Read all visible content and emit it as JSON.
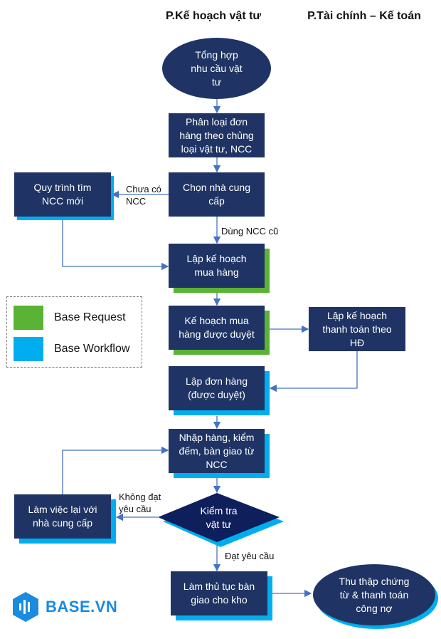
{
  "headers": {
    "left": "P.Kế hoạch vật tư",
    "right": "P.Tài chính – Kế toán"
  },
  "nodes": {
    "tong_hop": "Tổng hợp\nnhu cầu vật\ntư",
    "phan_loai": "Phân loại đơn\nhàng theo chủng\nloại vật tư, NCC",
    "chon_ncc": "Chọn nhà cung\ncấp",
    "quy_trinh": "Quy trình tìm\nNCC mới",
    "lap_ke_hoach": "Lập kế hoạch\nmua hàng",
    "ke_hoach_duyet": "Kế hoạch mua\nhàng được duyệt",
    "ke_hoach_thanh_toan": "Lập kế hoạch\nthanh toán theo\nHĐ",
    "lap_don_hang": "Lập đơn hàng\n(được duyệt)",
    "nhap_hang": "Nhập hàng, kiểm\nđếm, bàn giao từ\nNCC",
    "kiem_tra": "Kiểm tra\nvật tư",
    "lam_viec_lai": "Làm việc lại với\nnhà cung cấp",
    "ban_giao": "Làm thủ tục bàn\ngiao cho kho",
    "thu_thap": "Thu thập chứng\ntừ & thanh toán\ncông nợ"
  },
  "edge_labels": {
    "chua_co": "Chưa có\nNCC",
    "dung_ncc_cu": "Dùng NCC cũ",
    "khong_dat": "Không đạt\nyêu cầu",
    "dat": "Đạt yêu cầu"
  },
  "legend": {
    "items": [
      {
        "label": "Base Request",
        "color": "#5ab334"
      },
      {
        "label": "Base Workflow",
        "color": "#00aeef"
      }
    ]
  },
  "logo": {
    "text": "BASE.VN",
    "color": "#1a8be0"
  },
  "colors": {
    "node": "#1f3464",
    "arrow": "#4472c4"
  }
}
